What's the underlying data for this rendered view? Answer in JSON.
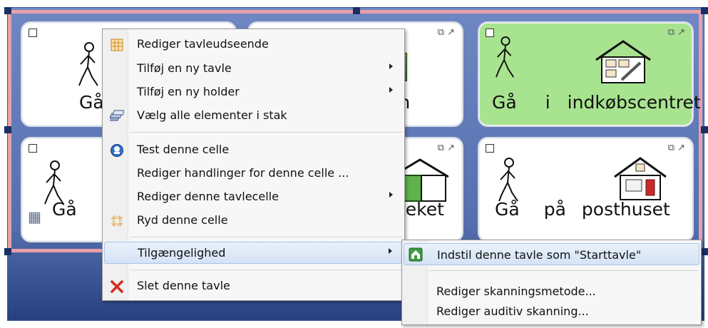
{
  "cells": [
    {
      "label": "Gå",
      "corner": "",
      "bg": "#ffffff"
    },
    {
      "label": "en",
      "corner": "⧉ ↗",
      "bg": "#ffffff"
    },
    {
      "label_words": [
        "Gå",
        "i",
        "indkøbscentret"
      ],
      "corner": "⧉ ↗",
      "bg": "#a8e38f"
    },
    {
      "label": "Gå",
      "corner": "",
      "bg": "#ffffff"
    },
    {
      "label": "teket",
      "corner": "⧉ ↗",
      "bg": "#ffffff"
    },
    {
      "label_words": [
        "Gå",
        "på",
        "posthuset"
      ],
      "corner": "⧉ ↗",
      "bg": "#ffffff"
    }
  ],
  "context_menu": {
    "items": [
      {
        "label": "Rediger tavleudseende",
        "icon": "grid-layout-icon"
      },
      {
        "label": "Tilføj en ny tavle",
        "submenu": true
      },
      {
        "label": "Tilføj en ny holder",
        "submenu": true
      },
      {
        "label": "Vælg alle elementer i stak",
        "icon": "stack-icon"
      },
      {
        "label": "Test denne celle",
        "icon": "test-icon"
      },
      {
        "label": "Rediger handlinger for denne celle ..."
      },
      {
        "label": "Rediger denne tavlecelle",
        "submenu": true
      },
      {
        "label": "Ryd denne celle",
        "icon": "clear-cell-icon"
      },
      {
        "label": "Tilgængelighed",
        "submenu": true,
        "highlighted": true
      },
      {
        "label": "Slet denne tavle",
        "icon": "delete-x-icon"
      }
    ]
  },
  "submenu": {
    "items": [
      {
        "label": "Indstil denne tavle som \"Starttavle\"",
        "icon": "home-icon",
        "highlighted": true
      },
      {
        "label": "Rediger skanningsmetode..."
      },
      {
        "label": "Rediger auditiv skanning..."
      }
    ]
  },
  "colors": {
    "board_blue": "#556fae",
    "selection_pink": "#e8a0a8",
    "green_cell": "#a8e38f",
    "menu_highlight": "#d4e3f6",
    "delete_red": "#d42a1e"
  }
}
